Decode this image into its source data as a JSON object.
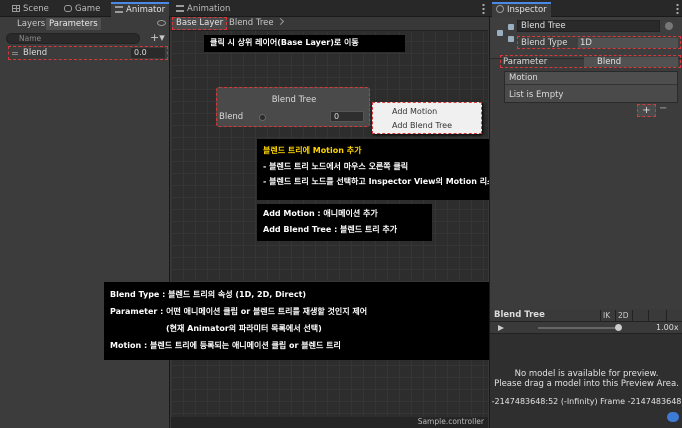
{
  "tabs": [
    {
      "label": "Scene",
      "icon": "grid-icon"
    },
    {
      "label": "Game",
      "icon": "gamepad-icon"
    },
    {
      "label": "Animator",
      "icon": "animator-icon"
    },
    {
      "label": "Animation",
      "icon": "animation-icon"
    },
    {
      "label": "Inspector",
      "icon": "info-icon"
    }
  ],
  "left_panel": {
    "subtabs": [
      "Layers",
      "Parameters"
    ],
    "search_placeholder": "Name",
    "add_label": "+▾",
    "parameter": {
      "name": "Blend",
      "value": "0.0"
    }
  },
  "graph": {
    "breadcrumbs": [
      "Base Layer",
      "Blend Tree"
    ],
    "node": {
      "title": "Blend Tree",
      "param_label": "Blend",
      "param_value": "0"
    },
    "context_menu": [
      "Add Motion",
      "Add Blend Tree"
    ],
    "status": "Sample.controller"
  },
  "annotations": {
    "breadcrumb_note": "클릭 시 상위 레이어(Base Layer)로 이동",
    "add_motion": {
      "title": "블렌드 트리에 Motion 추가",
      "line1": "- 블렌드 트리 노드에서 마우스 오른쪽 클릭",
      "line2": "- 블렌드 트리 노드를 선택하고 Inspector View의 Motion 리스트에서 \"+\" 버튼 선택"
    },
    "menu_items": {
      "line1": "Add Motion : 애니메이션 추가",
      "line2": "Add Blend Tree : 블렌드 트리 추가"
    },
    "properties": {
      "line1": "Blend Type : 블렌드 트리의 속성 (1D, 2D, Direct)",
      "line2": "Parameter : 어떤 애니메이션 클립 or 블렌드 트리를 재생할 것인지 제어",
      "line3": "(현재 Animator의 파라미터 목록에서 선택)",
      "line4": "Motion : 블렌드 트리에 등록되는 애니메이션 클립 or 블렌드 트리"
    }
  },
  "inspector": {
    "name": "Blend Tree",
    "blend_type_label": "Blend Type",
    "blend_type_value": "1D",
    "parameter_label": "Parameter",
    "parameter_value": "Blend",
    "motion_header": "Motion",
    "motion_empty": "List is Empty",
    "add_label": "+",
    "remove_label": "−",
    "preview": {
      "title": "Blend Tree",
      "tools": [
        "IK",
        "2D"
      ],
      "speed": "1.00x",
      "message_line1": "No model is available for preview.",
      "message_line2": "Please drag a model into this Preview Area.",
      "frame": "-2147483648:52 (-Infinity) Frame -2147483648"
    }
  },
  "colors": {
    "highlight_border": "#d43a3a",
    "annotation_bg": "#000000",
    "annotation_title": "#ffd400",
    "active_tab": "#4a8ae6"
  }
}
